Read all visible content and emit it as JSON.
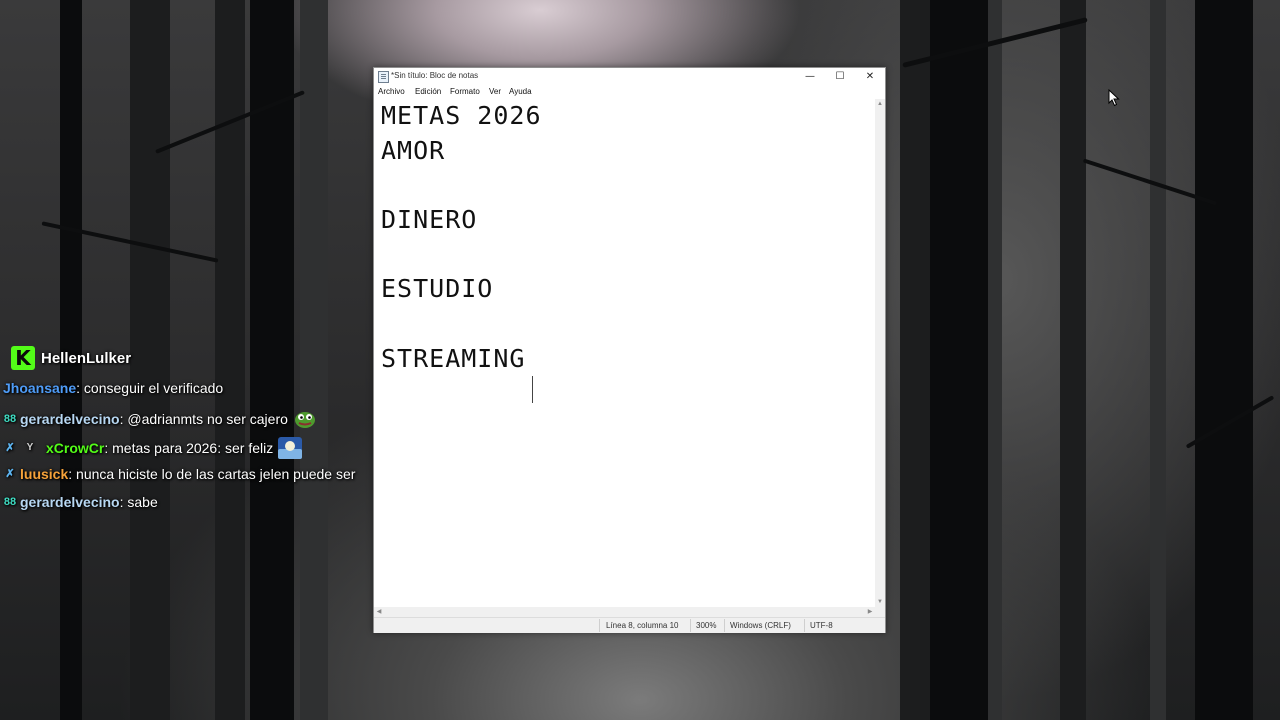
{
  "window": {
    "title": "*Sin título: Bloc de notas",
    "controls": {
      "minimize": "—",
      "maximize": "☐",
      "close": "✕"
    }
  },
  "menu": [
    "Archivo",
    "Edición",
    "Formato",
    "Ver",
    "Ayuda"
  ],
  "document": {
    "lines": [
      "METAS 2026",
      "AMOR",
      "",
      "DINERO",
      "",
      "ESTUDIO",
      "",
      "STREAMING"
    ]
  },
  "status": {
    "position": "Línea 8, columna 10",
    "zoom": "300%",
    "line_ending": "Windows (CRLF)",
    "encoding": "UTF-8"
  },
  "chat": {
    "streamer": "HellenLulker",
    "logo_letter": "K",
    "messages": [
      {
        "user": "Jhoansane",
        "user_color": "#4f9cf7",
        "text": ": conseguir el verificado",
        "badges": []
      },
      {
        "user": "gerardelvecino",
        "user_color": "#b7d7f2",
        "text": ": @adrianmts no ser cajero",
        "badges": [
          "badge-88"
        ],
        "emote": "pepe-emote"
      },
      {
        "user": "xCrowCr",
        "user_color": "#53fc18",
        "text": ": metas para 2026: ser feliz",
        "badges": [
          "sword-badge",
          "sub-badge"
        ],
        "emote": "sunset-emote"
      },
      {
        "user": "luusick",
        "user_color": "#f6a23a",
        "text": ": nunca hiciste lo de las cartas jelen puede ser",
        "badges": [
          "sword-badge"
        ]
      },
      {
        "user": "gerardelvecino",
        "user_color": "#b7d7f2",
        "text": ": sabe",
        "badges": [
          "badge-88"
        ]
      }
    ]
  },
  "colors": {
    "kick_green": "#53fc18",
    "badge_teal": "#3fdcc2",
    "badge_blue": "#5db4f0"
  }
}
